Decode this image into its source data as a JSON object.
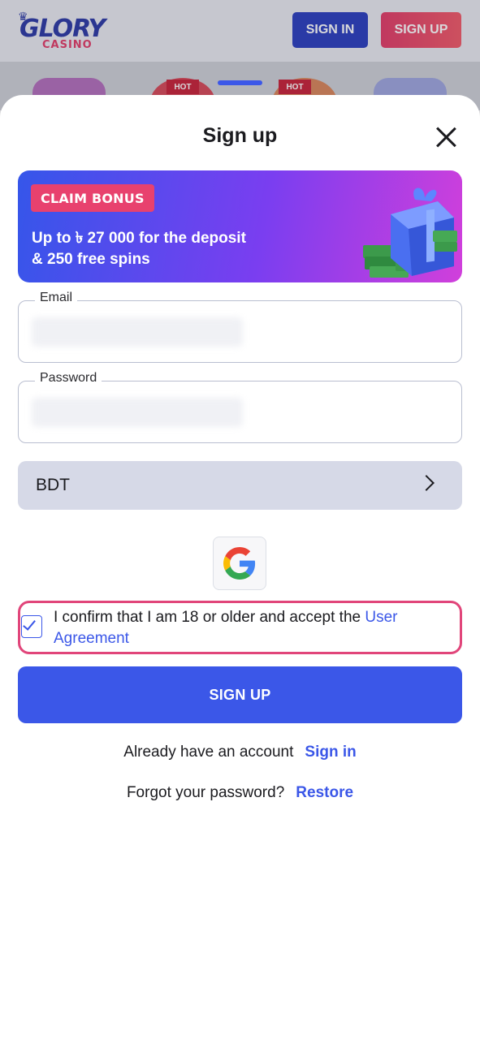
{
  "header": {
    "logo_top": "GLORY",
    "logo_bottom": "CASINO",
    "sign_in_label": "SIGN IN",
    "sign_up_label": "SIGN UP",
    "hot_badge": "HOT"
  },
  "modal": {
    "title": "Sign up",
    "banner": {
      "tag": "CLAIM BONUS",
      "line1": "Up to ৳ 27 000 for the deposit",
      "line2": "& 250 free spins"
    },
    "email": {
      "label": "Email",
      "value": ""
    },
    "password": {
      "label": "Password",
      "value": ""
    },
    "currency": {
      "value": "BDT"
    },
    "consent": {
      "checked": true,
      "text": "I confirm that I am 18 or older and accept the ",
      "link": "User Agreement"
    },
    "submit_label": "SIGN UP",
    "signin_prompt": "Already have an account",
    "signin_link": "Sign in",
    "forgot_prompt": "Forgot your password?",
    "restore_link": "Restore"
  },
  "colors": {
    "accent": "#3b57e8",
    "highlight": "#e1457a",
    "tag": "#e8416e"
  }
}
